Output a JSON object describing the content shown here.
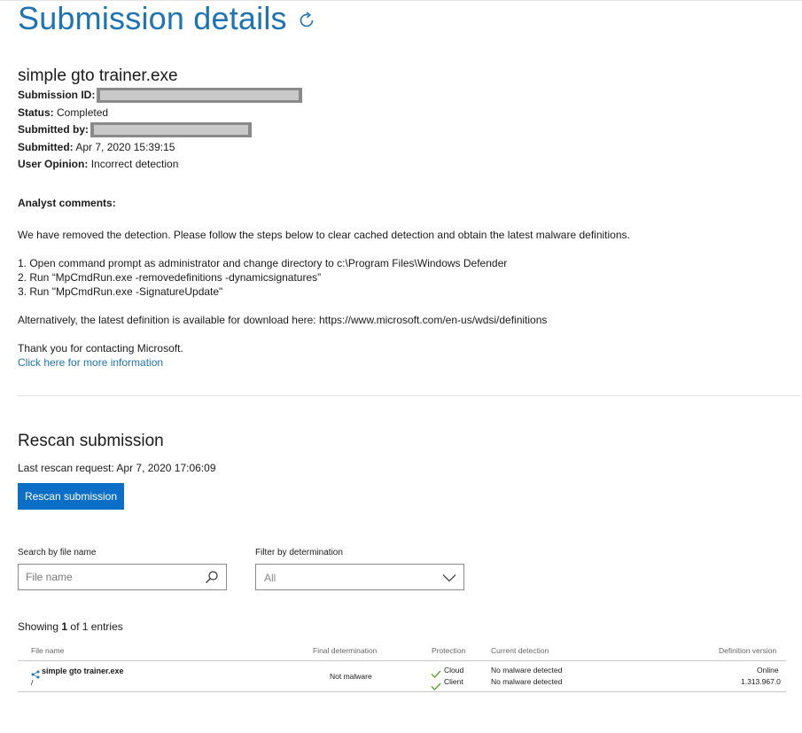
{
  "header": {
    "title": "Submission details",
    "refresh_icon": "refresh-icon"
  },
  "submission": {
    "file_name": "simple gto trainer.exe",
    "id_label": "Submission ID:",
    "status_label": "Status:",
    "status_value": "Completed",
    "submitted_by_label": "Submitted by:",
    "submitted_label": "Submitted:",
    "submitted_value": "Apr 7, 2020 15:39:15",
    "opinion_label": "User Opinion:",
    "opinion_value": "Incorrect detection"
  },
  "comments": {
    "heading": "Analyst comments:",
    "intro": "We have removed the detection. Please follow the steps below to clear cached detection and obtain the latest malware definitions.",
    "steps": [
      "1. Open command prompt as administrator and change directory to c:\\Program Files\\Windows Defender",
      "2. Run “MpCmdRun.exe -removedefinitions -dynamicsignatures”",
      "3. Run \"MpCmdRun.exe -SignatureUpdate\""
    ],
    "alternative": "Alternatively, the latest definition is available for download here: https://www.microsoft.com/en-us/wdsi/definitions",
    "thanks": "Thank you for contacting Microsoft.",
    "more_info_link": "Click here for more information"
  },
  "rescan": {
    "title": "Rescan submission",
    "last_request": "Last rescan request: Apr 7, 2020 17:06:09",
    "button_label": "Rescan submission"
  },
  "filters": {
    "search_label": "Search by file name",
    "search_placeholder": "File name",
    "determination_label": "Filter by determination",
    "determination_value": "All"
  },
  "results": {
    "showing_prefix": "Showing ",
    "showing_count": "1",
    "showing_suffix": " of 1 entries",
    "columns": {
      "file_name": "File name",
      "final_determination": "Final determination",
      "protection": "Protection",
      "current_detection": "Current detection",
      "definition_version": "Definition version"
    },
    "rows": [
      {
        "file_name": "simple gto trainer.exe",
        "path": "/",
        "final_determination": "Not malware",
        "protections": [
          {
            "type": "Cloud",
            "detection": "No malware detected",
            "version": "Online"
          },
          {
            "type": "Client",
            "detection": "No malware detected",
            "version": "1.313.967.0"
          }
        ]
      }
    ]
  },
  "colors": {
    "accent": "#1e73b4",
    "button": "#0b6fc7",
    "check": "#5aa02c"
  }
}
